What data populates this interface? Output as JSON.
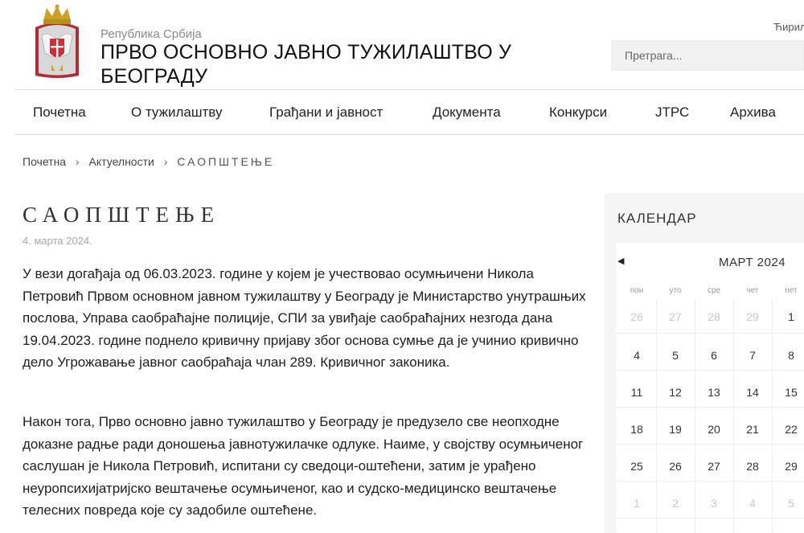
{
  "header": {
    "republic": "Република Србија",
    "institution_title": "ПРВО ОСНОВНО ЈАВНО ТУЖИЛАШТВО У БЕОГРАДУ",
    "language": "Ћирилица",
    "search_placeholder": "Претрага..."
  },
  "nav": {
    "items": [
      "Почетна",
      "О тужилаштву",
      "Грађани и јавност",
      "Документа",
      "Конкурси",
      "ЈТРС",
      "Архива"
    ]
  },
  "breadcrumb": {
    "home": "Почетна",
    "section": "Актуелности",
    "current": "САОПШТЕЊЕ",
    "separator": "›"
  },
  "article": {
    "title": "САОПШТЕЊЕ",
    "date": "4. марта 2024.",
    "paragraphs": [
      "У вези догађаја од 06.03.2023. године у којем је учествовао осумњичени Никола Петровић Првом основном јавном тужилаштву у Београду је Министарство унутрашњих послова, Управа саобраћајне полиције, СПИ за увиђаје саобраћајних незгода дана 19.04.2023. године поднело кривичну пријаву због основа сумње да је учинио кривично дело Угрожавање јавног саобраћаја члан 289. Кривичног законика.",
      "Након тога, Прво основно јавно тужилаштво у Београду је предузело све неопходне доказне радње ради доношења јавнотужилачке одлуке. Наиме, у својству осумњиченог саслушан је Никола Петровић, испитани су сведоци-оштећени, затим је урађено неуропсихијатријско вештачење осумњиченог, као и судско-медицинско вештачење телесних повреда које су задобиле оштећене."
    ]
  },
  "calendar": {
    "heading": "КАЛЕНДАР",
    "month": "МАРТ 2024",
    "prev_icon": "triangle-left-icon",
    "weekdays": [
      "пон",
      "уто",
      "сре",
      "чет",
      "пет"
    ],
    "weeks": [
      [
        {
          "d": "26",
          "m": true
        },
        {
          "d": "27",
          "m": true
        },
        {
          "d": "28",
          "m": true
        },
        {
          "d": "29",
          "m": true
        },
        {
          "d": "1",
          "m": false
        }
      ],
      [
        {
          "d": "4",
          "m": false
        },
        {
          "d": "5",
          "m": false
        },
        {
          "d": "6",
          "m": false
        },
        {
          "d": "7",
          "m": false
        },
        {
          "d": "8",
          "m": false
        }
      ],
      [
        {
          "d": "11",
          "m": false
        },
        {
          "d": "12",
          "m": false
        },
        {
          "d": "13",
          "m": false
        },
        {
          "d": "14",
          "m": false
        },
        {
          "d": "15",
          "m": false
        }
      ],
      [
        {
          "d": "18",
          "m": false
        },
        {
          "d": "19",
          "m": false
        },
        {
          "d": "20",
          "m": false
        },
        {
          "d": "21",
          "m": false
        },
        {
          "d": "22",
          "m": false
        }
      ],
      [
        {
          "d": "25",
          "m": false
        },
        {
          "d": "26",
          "m": false
        },
        {
          "d": "27",
          "m": false
        },
        {
          "d": "28",
          "m": false
        },
        {
          "d": "29",
          "m": false
        }
      ],
      [
        {
          "d": "1",
          "m": true
        },
        {
          "d": "2",
          "m": true
        },
        {
          "d": "3",
          "m": true
        },
        {
          "d": "4",
          "m": true
        },
        {
          "d": "5",
          "m": true
        }
      ]
    ]
  },
  "colors": {
    "shield_red": "#c8303a",
    "crown_gold": "#c9a227",
    "eagle_white": "#f4f4f4"
  }
}
